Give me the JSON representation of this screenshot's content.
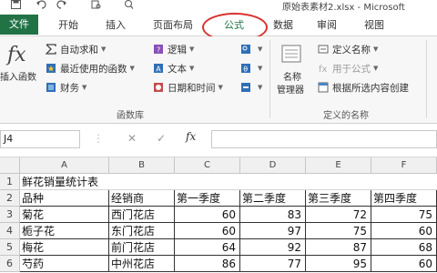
{
  "window": {
    "title": "原始表素材2.xlsx - Microsoft"
  },
  "tabs": [
    {
      "label": "文件"
    },
    {
      "label": "开始"
    },
    {
      "label": "插入"
    },
    {
      "label": "页面布局"
    },
    {
      "label": "公式"
    },
    {
      "label": "数据"
    },
    {
      "label": "审阅"
    },
    {
      "label": "视图"
    }
  ],
  "ribbon": {
    "insert_function": "插入函数",
    "library": {
      "autosum": "自动求和",
      "recent": "最近使用的函数",
      "financial": "财务",
      "logical": "逻辑",
      "text": "文本",
      "datetime": "日期和时间",
      "group_label": "函数库"
    },
    "names": {
      "name_manager_line1": "名称",
      "name_manager_line2": "管理器",
      "define_name": "定义名称",
      "use_in_formula": "用于公式",
      "create_from_selection": "根据所选内容创建",
      "group_label": "定义的名称"
    }
  },
  "formula_bar": {
    "name_box": "J4",
    "cancel": "✕",
    "enter": "✓",
    "fx": "fx",
    "formula": ""
  },
  "sheet": {
    "columns": [
      "A",
      "B",
      "C",
      "D",
      "E",
      "F"
    ],
    "rows": [
      {
        "num": "1",
        "cells": [
          "鲜花销量统计表",
          "",
          "",
          "",
          "",
          ""
        ]
      },
      {
        "num": "2",
        "cells": [
          "品种",
          "经销商",
          "第一季度",
          "第二季度",
          "第三季度",
          "第四季度"
        ]
      },
      {
        "num": "3",
        "cells": [
          "菊花",
          "西门花店",
          "60",
          "83",
          "72",
          "75"
        ]
      },
      {
        "num": "4",
        "cells": [
          "栀子花",
          "东门花店",
          "60",
          "97",
          "75",
          "60"
        ]
      },
      {
        "num": "5",
        "cells": [
          "梅花",
          "前门花店",
          "64",
          "92",
          "87",
          "68"
        ]
      },
      {
        "num": "6",
        "cells": [
          "芍药",
          "中州花店",
          "86",
          "77",
          "95",
          "60"
        ]
      }
    ]
  },
  "colors": {
    "accent": "#217346",
    "highlight": "#d8322f"
  }
}
